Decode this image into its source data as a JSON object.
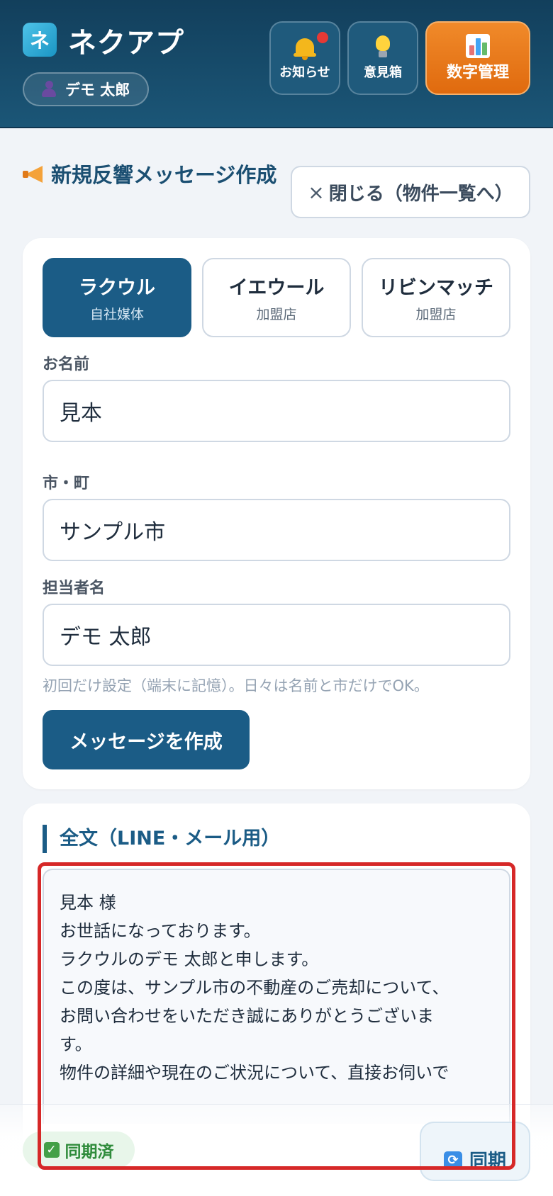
{
  "header": {
    "logo_char": "ネ",
    "app_name": "ネクアプ",
    "user_name": "デモ 太郎",
    "buttons": {
      "notice": "お知らせ",
      "idea": "意見箱",
      "numbers": "数字管理"
    }
  },
  "page": {
    "title": "新規反響メッセージ作成",
    "close_label": "閉じる（物件一覧へ）",
    "close_icon": "×"
  },
  "media_tabs": [
    {
      "name": "ラクウル",
      "type": "自社媒体",
      "active": true
    },
    {
      "name": "イエウール",
      "type": "加盟店",
      "active": false
    },
    {
      "name": "リビンマッチ",
      "type": "加盟店",
      "active": false
    }
  ],
  "form": {
    "name_label": "お名前",
    "name_value": "見本",
    "city_label": "市・町",
    "city_value": "サンプル市",
    "staff_label": "担当者名",
    "staff_value": "デモ 太郎",
    "hint": "初回だけ設定（端末に記憶）。日々は名前と市だけでOK。",
    "submit_label": "メッセージを作成"
  },
  "output": {
    "title": "全文（LINE・メール用）",
    "lines": [
      "見本 様",
      "",
      "お世話になっております。",
      "ラクウルのデモ 太郎と申します。",
      "この度は、サンプル市の不動産のご売却について、",
      "お問い合わせをいただき誠にありがとうございま",
      "す。",
      "物件の詳細や現在のご状況について、直接お伺いで"
    ]
  },
  "footer": {
    "synced_label": "同期済",
    "sync_button": "同期",
    "check_glyph": "✓",
    "sync_glyph": "⟳"
  },
  "colors": {
    "header_bg": "#1b5677",
    "accent": "#1b5c86",
    "orange": "#e87a1c",
    "highlight": "#d62828"
  }
}
